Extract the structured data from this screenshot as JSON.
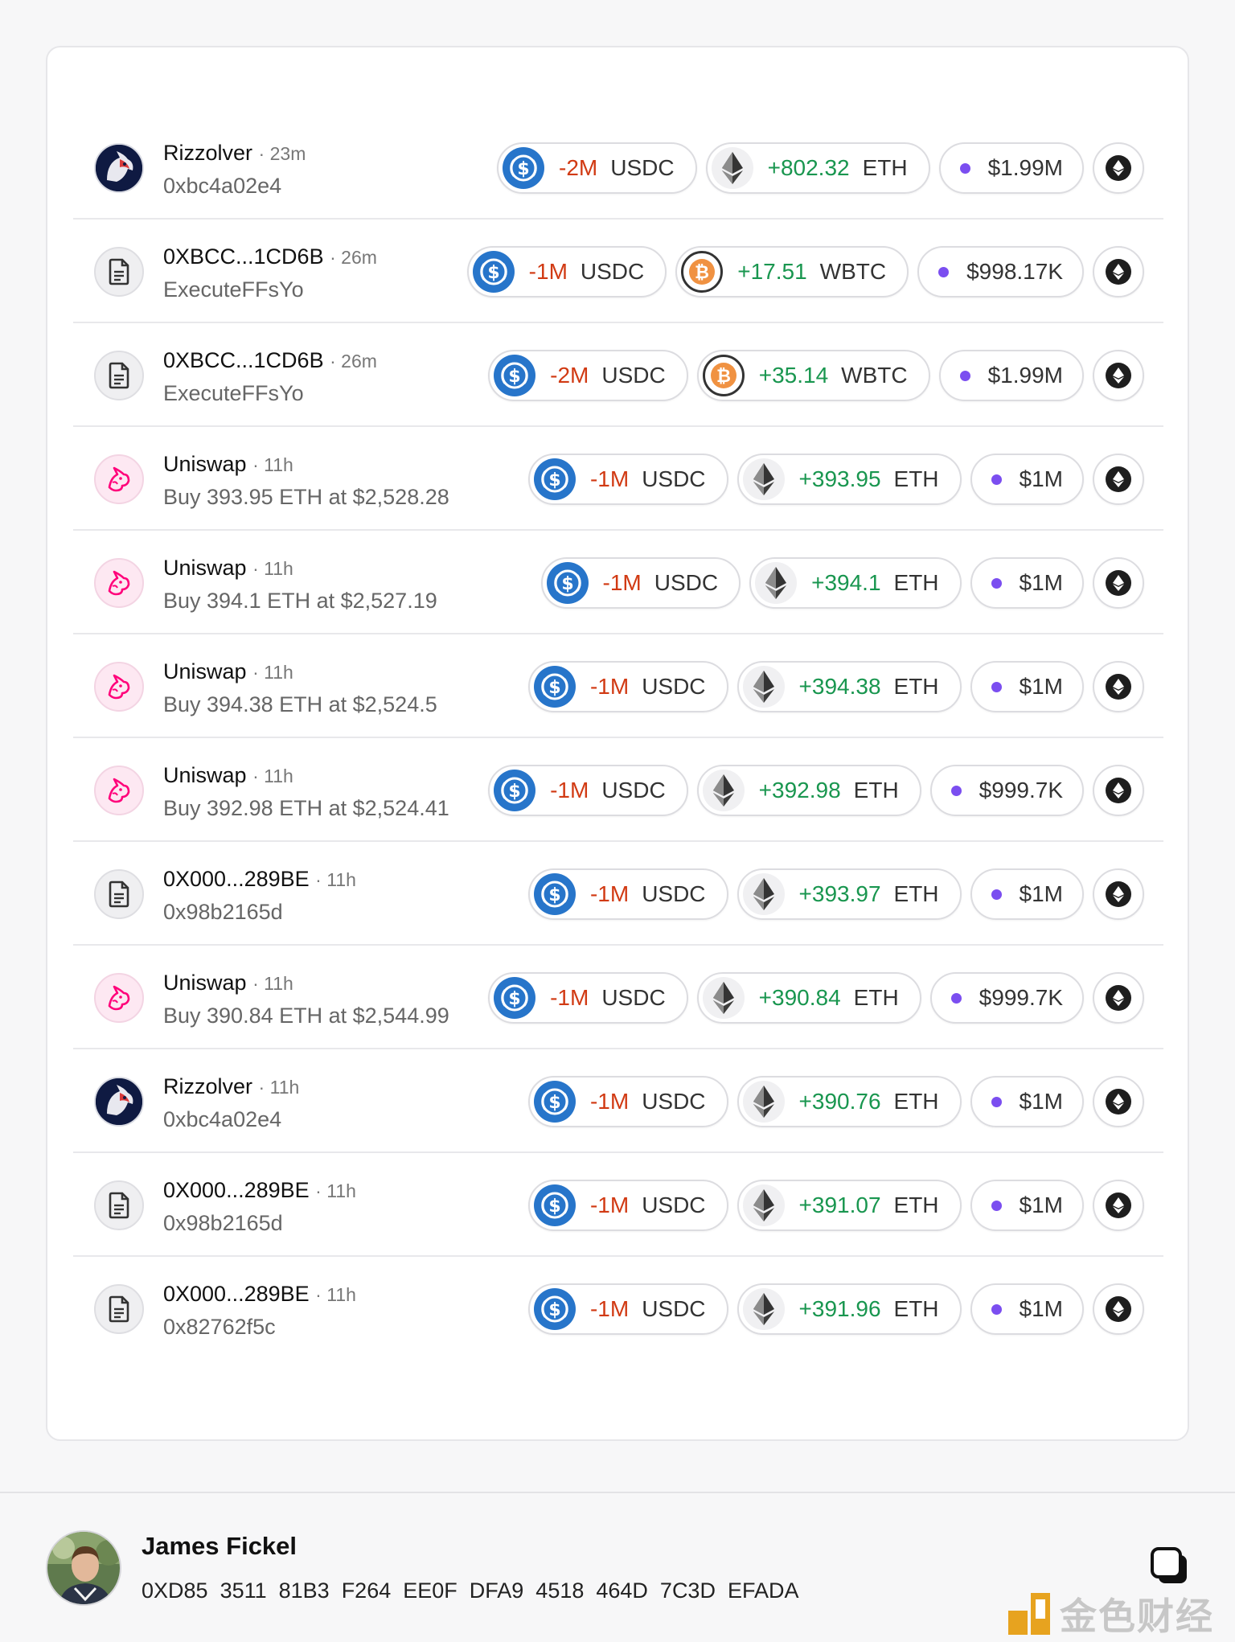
{
  "rows": [
    {
      "avatar": "rizzolver",
      "name": "Rizzolver",
      "time": "23m",
      "sub": "0xbc4a02e4",
      "sell_amount": "-2M",
      "sell_symbol": "USDC",
      "buy_coin": "eth",
      "buy_amount": "+802.32",
      "buy_symbol": "ETH",
      "usd": "$1.99M"
    },
    {
      "avatar": "doc",
      "name": "0XBCC...1CD6B",
      "time": "26m",
      "sub": "ExecuteFFsYo",
      "sell_amount": "-1M",
      "sell_symbol": "USDC",
      "buy_coin": "wbtc",
      "buy_amount": "+17.51",
      "buy_symbol": "WBTC",
      "usd": "$998.17K"
    },
    {
      "avatar": "doc",
      "name": "0XBCC...1CD6B",
      "time": "26m",
      "sub": "ExecuteFFsYo",
      "sell_amount": "-2M",
      "sell_symbol": "USDC",
      "buy_coin": "wbtc",
      "buy_amount": "+35.14",
      "buy_symbol": "WBTC",
      "usd": "$1.99M"
    },
    {
      "avatar": "uniswap",
      "name": "Uniswap",
      "time": "11h",
      "sub": "Buy 393.95 ETH at $2,528.28",
      "sell_amount": "-1M",
      "sell_symbol": "USDC",
      "buy_coin": "eth",
      "buy_amount": "+393.95",
      "buy_symbol": "ETH",
      "usd": "$1M"
    },
    {
      "avatar": "uniswap",
      "name": "Uniswap",
      "time": "11h",
      "sub": "Buy 394.1 ETH at $2,527.19",
      "sell_amount": "-1M",
      "sell_symbol": "USDC",
      "buy_coin": "eth",
      "buy_amount": "+394.1",
      "buy_symbol": "ETH",
      "usd": "$1M"
    },
    {
      "avatar": "uniswap",
      "name": "Uniswap",
      "time": "11h",
      "sub": "Buy 394.38 ETH at $2,524.5",
      "sell_amount": "-1M",
      "sell_symbol": "USDC",
      "buy_coin": "eth",
      "buy_amount": "+394.38",
      "buy_symbol": "ETH",
      "usd": "$1M"
    },
    {
      "avatar": "uniswap",
      "name": "Uniswap",
      "time": "11h",
      "sub": "Buy 392.98 ETH at $2,524.41",
      "sell_amount": "-1M",
      "sell_symbol": "USDC",
      "buy_coin": "eth",
      "buy_amount": "+392.98",
      "buy_symbol": "ETH",
      "usd": "$999.7K"
    },
    {
      "avatar": "doc",
      "name": "0X000...289BE",
      "time": "11h",
      "sub": "0x98b2165d",
      "sell_amount": "-1M",
      "sell_symbol": "USDC",
      "buy_coin": "eth",
      "buy_amount": "+393.97",
      "buy_symbol": "ETH",
      "usd": "$1M"
    },
    {
      "avatar": "uniswap",
      "name": "Uniswap",
      "time": "11h",
      "sub": "Buy 390.84 ETH at $2,544.99",
      "sell_amount": "-1M",
      "sell_symbol": "USDC",
      "buy_coin": "eth",
      "buy_amount": "+390.84",
      "buy_symbol": "ETH",
      "usd": "$999.7K"
    },
    {
      "avatar": "rizzolver",
      "name": "Rizzolver",
      "time": "11h",
      "sub": "0xbc4a02e4",
      "sell_amount": "-1M",
      "sell_symbol": "USDC",
      "buy_coin": "eth",
      "buy_amount": "+390.76",
      "buy_symbol": "ETH",
      "usd": "$1M"
    },
    {
      "avatar": "doc",
      "name": "0X000...289BE",
      "time": "11h",
      "sub": "0x98b2165d",
      "sell_amount": "-1M",
      "sell_symbol": "USDC",
      "buy_coin": "eth",
      "buy_amount": "+391.07",
      "buy_symbol": "ETH",
      "usd": "$1M"
    },
    {
      "avatar": "doc",
      "name": "0X000...289BE",
      "time": "11h",
      "sub": "0x82762f5c",
      "sell_amount": "-1M",
      "sell_symbol": "USDC",
      "buy_coin": "eth",
      "buy_amount": "+391.96",
      "buy_symbol": "ETH",
      "usd": "$1M"
    }
  ],
  "separator": "·",
  "footer": {
    "user_name": "James Fickel",
    "address_parts": [
      "0XD85",
      "3511",
      "81B3",
      "F264",
      "EE0F",
      "DFA9",
      "4518",
      "464D",
      "7C3D",
      "EFADA"
    ]
  },
  "watermark": {
    "text": "金色财经"
  },
  "colors": {
    "negative": "#d13a13",
    "positive": "#19964f",
    "usdc": "#2775ca",
    "usd_dot": "#7b4ef0"
  },
  "icons": {
    "usdc": "usdc-icon",
    "eth": "eth-icon",
    "wbtc": "wbtc-icon",
    "doc": "document-icon",
    "uniswap": "uniswap-unicorn-icon",
    "rizzolver": "rizzolver-unicorn-icon",
    "chain": "ethereum-chain-icon",
    "copy": "copy-icon"
  }
}
